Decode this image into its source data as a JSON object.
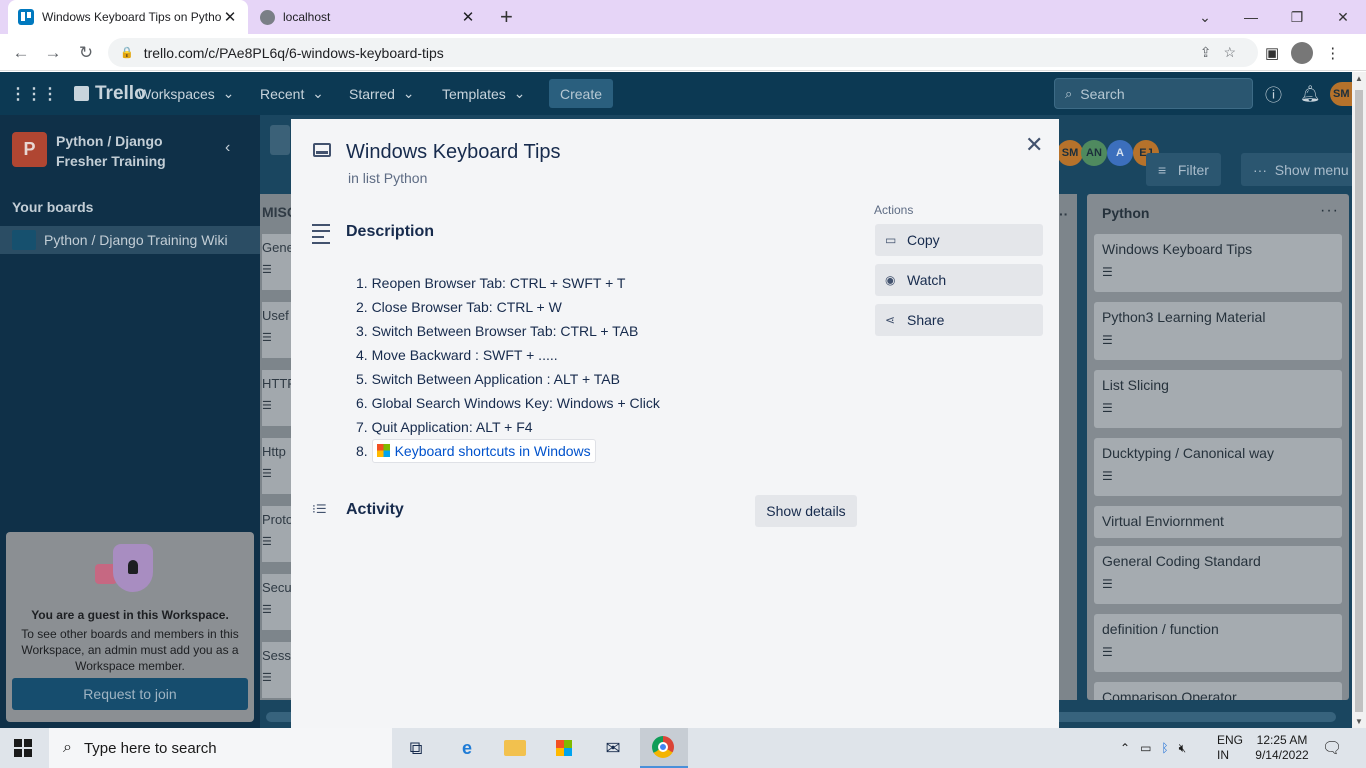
{
  "browser": {
    "tabs": [
      {
        "title": "Windows Keyboard Tips on Pytho",
        "active": true
      },
      {
        "title": "localhost",
        "active": false
      }
    ],
    "url": "trello.com/c/PAe8PL6q/6-windows-keyboard-tips"
  },
  "header": {
    "logo": "Trello",
    "nav": [
      "Workspaces",
      "Recent",
      "Starred",
      "Templates"
    ],
    "create": "Create",
    "search_placeholder": "Search",
    "user_initials": "SM"
  },
  "sidebar": {
    "workspace_initial": "P",
    "workspace_name": "Python / Django Fresher Training",
    "your_boards": "Your boards",
    "boards": [
      "Python / Django Training Wiki"
    ],
    "guest_title": "You are a guest in this Workspace.",
    "guest_text": "To see other boards and members in this Workspace, an admin must add you as a Workspace member.",
    "join_button": "Request to join"
  },
  "board": {
    "members": [
      "SM",
      "AN",
      "A",
      "EJ"
    ],
    "filter": "Filter",
    "show_menu": "Show menu",
    "left_list": {
      "title": "MISC",
      "cards": [
        "Gene",
        "Usef",
        "HTTP",
        "Http",
        "Proto",
        "Secu",
        "Sessi"
      ]
    },
    "python_list": {
      "title": "Python",
      "cards": [
        {
          "title": "Windows Keyboard Tips",
          "has_desc": true
        },
        {
          "title": "Python3 Learning Material",
          "has_desc": true
        },
        {
          "title": "List Slicing",
          "has_desc": true
        },
        {
          "title": "Ducktyping / Canonical way",
          "has_desc": true
        },
        {
          "title": "Virtual Enviornment",
          "has_desc": false
        },
        {
          "title": "General Coding Standard",
          "has_desc": true
        },
        {
          "title": "definition / function",
          "has_desc": true
        },
        {
          "title": "Comparison Operator",
          "has_desc": false
        }
      ]
    }
  },
  "card": {
    "title": "Windows Keyboard Tips",
    "in_list": "in list Python",
    "description_label": "Description",
    "description_items": [
      "1. Reopen Browser Tab: CTRL + SWFT + T",
      "2. Close Browser Tab: CTRL + W",
      "3. Switch Between Browser Tab: CTRL + TAB",
      "4. Move Backward : SWFT + .....",
      "5. Switch Between Application : ALT + TAB",
      "6. Global Search Windows Key: Windows + Click",
      "7. Quit Application: ALT + F4"
    ],
    "link_item_number": "8.",
    "link_text": "Keyboard shortcuts in Windows",
    "activity_label": "Activity",
    "show_details": "Show details",
    "actions_label": "Actions",
    "actions": [
      "Copy",
      "Watch",
      "Share"
    ]
  },
  "taskbar": {
    "search_placeholder": "Type here to search",
    "lang_line1": "ENG",
    "lang_line2": "IN",
    "time": "12:25 AM",
    "date": "9/14/2022"
  }
}
